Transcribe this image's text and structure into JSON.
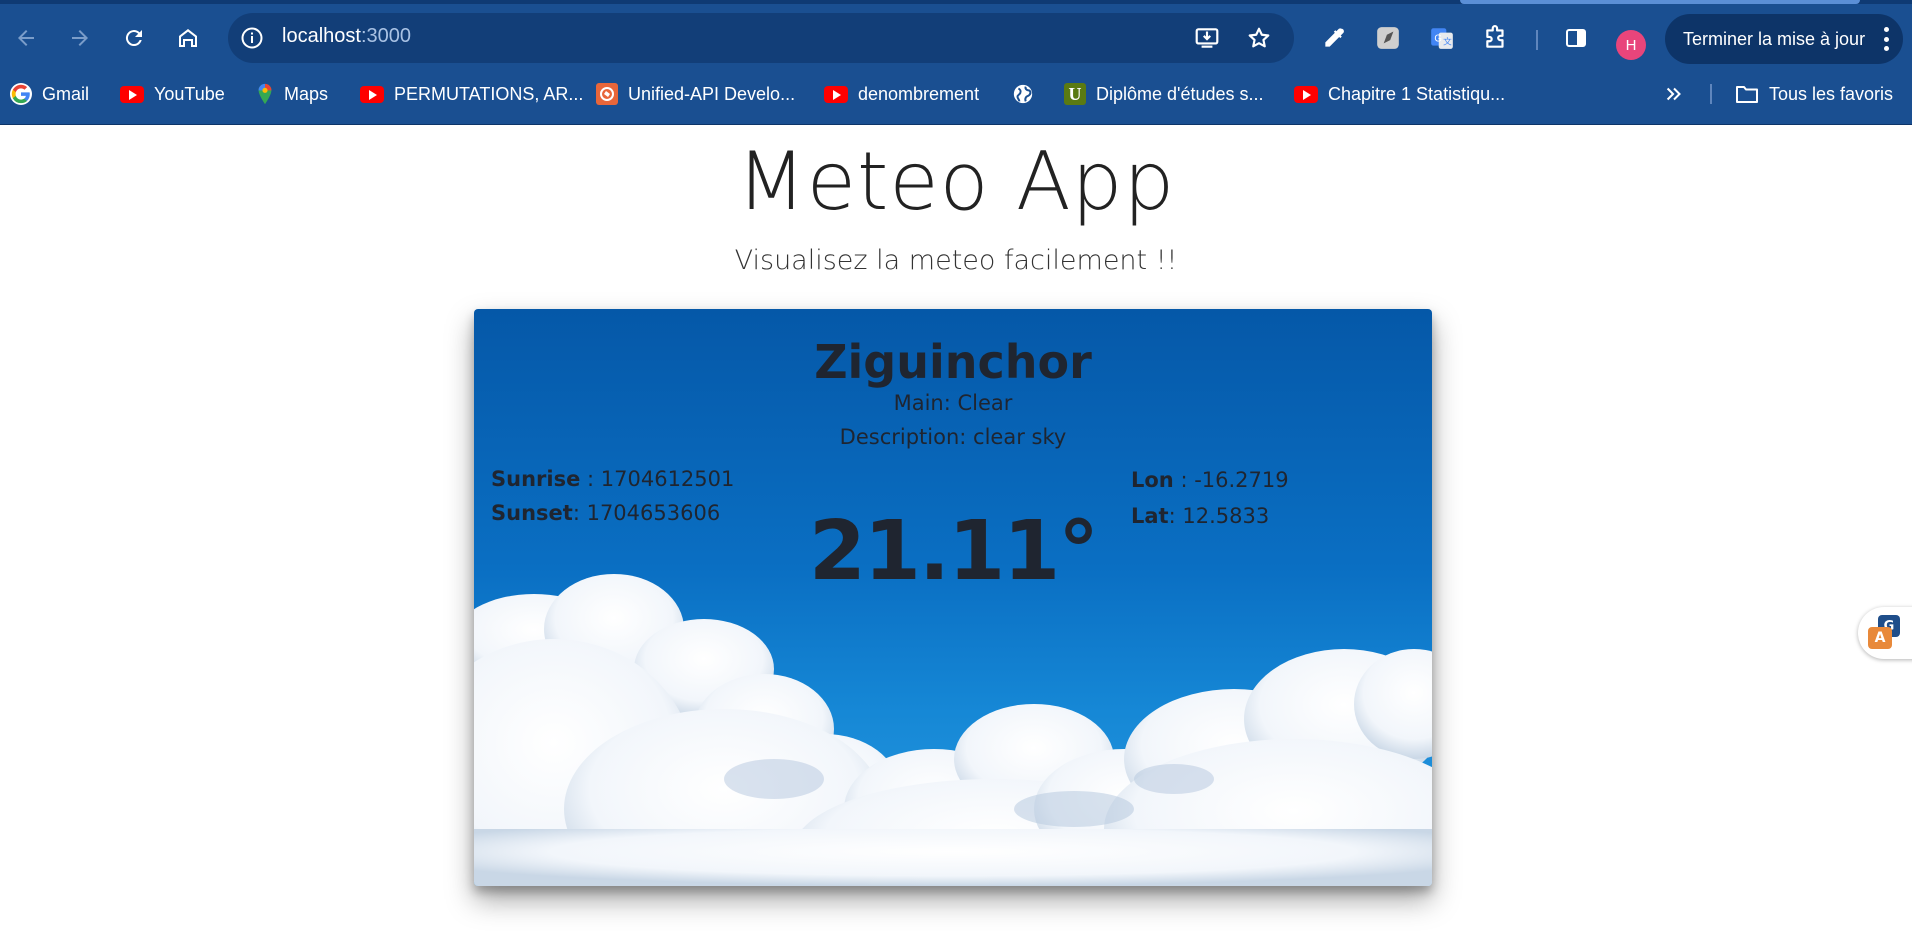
{
  "browser": {
    "url_host": "localhost",
    "url_port": ":3000",
    "update_button_label": "Terminer la mise à jour",
    "profile_initial": "H",
    "bookmarks": [
      {
        "label": "Gmail",
        "icon": "google-icon"
      },
      {
        "label": "YouTube",
        "icon": "youtube-icon"
      },
      {
        "label": "Maps",
        "icon": "maps-icon"
      },
      {
        "label": "PERMUTATIONS, AR...",
        "icon": "youtube-icon"
      },
      {
        "label": "Unified-API Develo...",
        "icon": "unified-api-icon"
      },
      {
        "label": "denombrement",
        "icon": "youtube-icon"
      },
      {
        "label": "",
        "icon": "globe-icon"
      },
      {
        "label": "Diplôme d'études s...",
        "icon": "u-icon"
      },
      {
        "label": "Chapitre 1 Statistiqu...",
        "icon": "youtube-icon"
      }
    ],
    "all_bookmarks_label": "Tous les favoris",
    "u_icon_letter": "U",
    "colors": {
      "chrome": "#1a4f91",
      "omnibox": "#123e78",
      "update_button": "#0d3468",
      "avatar": "#e8457b"
    }
  },
  "page": {
    "title": "Meteo App",
    "subtitle": "Visualisez la meteo facilement !!"
  },
  "weather": {
    "city": "Ziguinchor",
    "main_label": "Main",
    "main_value": "Clear",
    "description_label": "Description",
    "description_value": "clear sky",
    "sunrise_label": "Sunrise",
    "sunrise_value": "1704612501",
    "sunset_label": "Sunset",
    "sunset_value": "1704653606",
    "temperature": "21.11°",
    "lon_label": "Lon",
    "lon_value": "-16.2719",
    "lat_label": "Lat",
    "lat_value": "12.5833"
  }
}
